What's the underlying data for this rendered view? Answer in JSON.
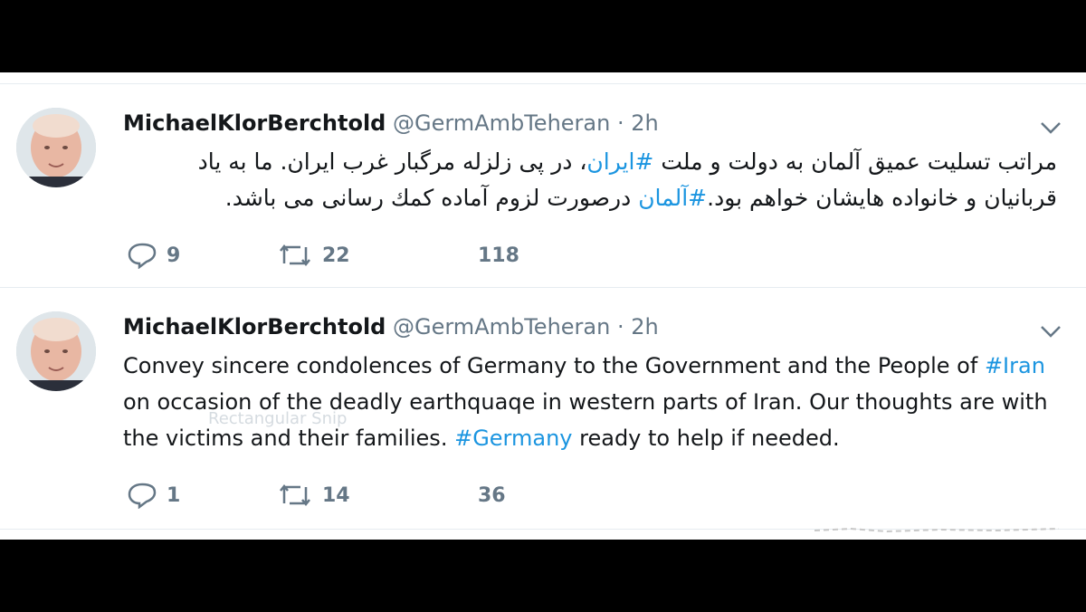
{
  "tweets": [
    {
      "name": "MichaelKlorBerchtold",
      "handle": "@GermAmbTeheran",
      "sep": "·",
      "time": "2h",
      "text_parts": [
        {
          "t": "مراتب تسلیت عمیق آلمان به دولت و ملت ",
          "hash": false
        },
        {
          "t": "#ایران",
          "hash": true
        },
        {
          "t": "، در پی زلزله مرگبار غرب ایران. ما به یاد قربانیان و خانواده هایشان خواهم بود.",
          "hash": false
        },
        {
          "t": "#آلمان",
          "hash": true
        },
        {
          "t": " درصورت لزوم آماده کمك رسانی می باشد.",
          "hash": false
        }
      ],
      "replies": "9",
      "retweets": "22",
      "likes": "118"
    },
    {
      "name": "MichaelKlorBerchtold",
      "handle": "@GermAmbTeheran",
      "sep": "·",
      "time": "2h",
      "text_parts": [
        {
          "t": "Convey sincere condolences of Germany to the Government and the People of ",
          "hash": false
        },
        {
          "t": "#Iran",
          "hash": true
        },
        {
          "t": " on occasion of the deadly earthquaqe in western parts of Iran. Our thoughts are with the victims and their families. ",
          "hash": false
        },
        {
          "t": "#Germany",
          "hash": true
        },
        {
          "t": " ready to help if needed.",
          "hash": false
        }
      ],
      "replies": "1",
      "retweets": "14",
      "likes": "36"
    }
  ],
  "ghost_text": "Rectangular Snip",
  "icons": {
    "reply": "reply-icon",
    "retweet": "retweet-icon",
    "chevron": "chevron-down-icon",
    "avatar": "avatar"
  },
  "colors": {
    "hashtag": "#1b95e0",
    "secondary": "#657786",
    "text": "#14171a"
  }
}
